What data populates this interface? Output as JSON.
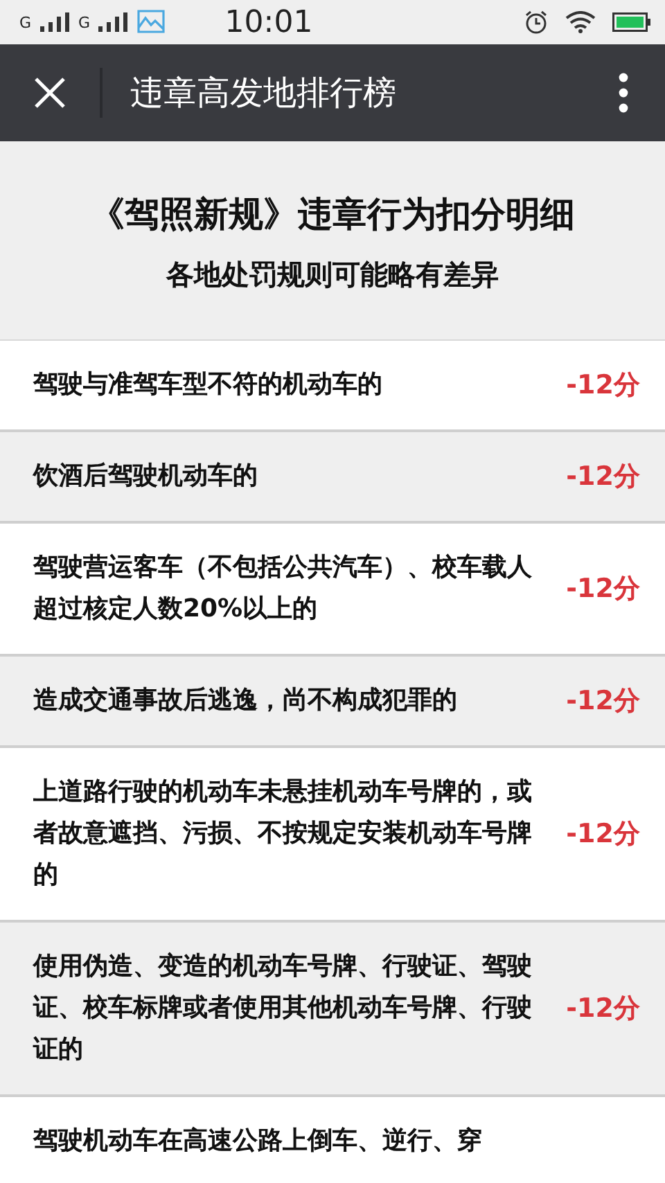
{
  "status_bar": {
    "time": "10:01",
    "sim_1": "G",
    "sim_2": "G"
  },
  "app_bar": {
    "title": "违章高发地排行榜"
  },
  "header": {
    "title": "《驾照新规》违章行为扣分明细",
    "subtitle": "各地处罚规则可能略有差异"
  },
  "violations": [
    {
      "text": "驾驶与准驾车型不符的机动车的",
      "penalty": "-12分"
    },
    {
      "text": "饮酒后驾驶机动车的",
      "penalty": "-12分"
    },
    {
      "text": "驾驶营运客车（不包括公共汽车）、校车载人超过核定人数20%以上的",
      "penalty": "-12分"
    },
    {
      "text": "造成交通事故后逃逸，尚不构成犯罪的",
      "penalty": "-12分"
    },
    {
      "text": "上道路行驶的机动车未悬挂机动车号牌的，或者故意遮挡、污损、不按规定安装机动车号牌的",
      "penalty": "-12分"
    },
    {
      "text": "使用伪造、变造的机动车号牌、行驶证、驾驶证、校车标牌或者使用其他机动车号牌、行驶证的",
      "penalty": "-12分"
    },
    {
      "text": "驾驶机动车在高速公路上倒车、逆行、穿"
    }
  ]
}
